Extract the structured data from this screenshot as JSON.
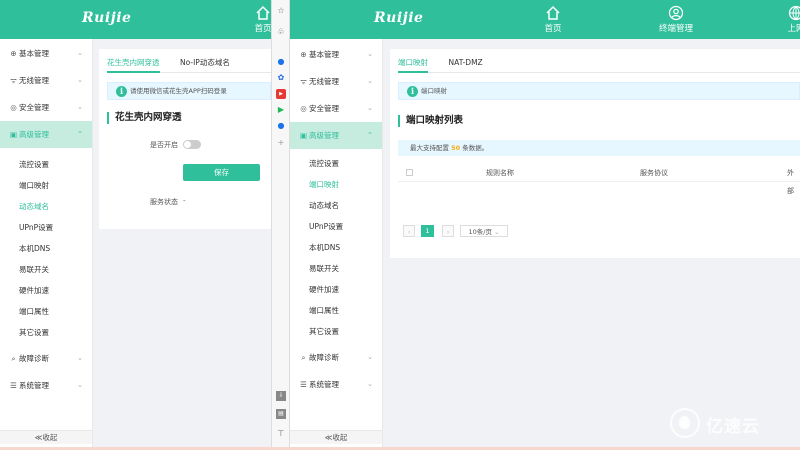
{
  "left_window": {
    "brand": "Ruijie",
    "nav": [
      {
        "label": "首页",
        "icon": "home-icon"
      }
    ],
    "sidebar": {
      "items": [
        {
          "label": "基本管理",
          "icon": "globe-icon"
        },
        {
          "label": "无线管理",
          "icon": "wifi-icon"
        },
        {
          "label": "安全管理",
          "icon": "shield-icon"
        },
        {
          "label": "高级管理",
          "icon": "advanced-icon",
          "active": true
        }
      ],
      "sub_items": [
        "流控设置",
        "端口映射",
        "动态域名",
        "UPnP设置",
        "本机DNS",
        "易联开关",
        "硬件加速",
        "端口属性",
        "其它设置"
      ],
      "active_sub": "动态域名",
      "bottom_items": [
        {
          "label": "故障诊断",
          "icon": "diagnose-icon"
        },
        {
          "label": "系统管理",
          "icon": "system-icon"
        }
      ],
      "collapse_label": "≪收起"
    },
    "tabs": [
      "花生壳内网穿透",
      "No-IP动态域名"
    ],
    "alert_text": "请使用微信或花生壳APP扫码登录",
    "section_title": "花生壳内网穿透",
    "enable_label": "是否开启",
    "enable_value": false,
    "save_label": "保存",
    "status_label": "服务状态",
    "status_value": "-"
  },
  "right_window": {
    "brand": "Ruijie",
    "nav": [
      {
        "label": "首页",
        "icon": "home-icon"
      },
      {
        "label": "终端管理",
        "icon": "user-icon"
      },
      {
        "label": "上网",
        "icon": "globe-icon"
      }
    ],
    "sidebar": {
      "items": [
        {
          "label": "基本管理",
          "icon": "globe-icon"
        },
        {
          "label": "无线管理",
          "icon": "wifi-icon"
        },
        {
          "label": "安全管理",
          "icon": "shield-icon"
        },
        {
          "label": "高级管理",
          "icon": "advanced-icon",
          "active": true
        }
      ],
      "sub_items": [
        "流控设置",
        "端口映射",
        "动态域名",
        "UPnP设置",
        "本机DNS",
        "易联开关",
        "硬件加速",
        "端口属性",
        "其它设置"
      ],
      "active_sub": "端口映射",
      "bottom_items": [
        {
          "label": "故障诊断",
          "icon": "diagnose-icon"
        },
        {
          "label": "系统管理",
          "icon": "system-icon"
        }
      ],
      "collapse_label": "≪收起"
    },
    "tabs": [
      "端口映射",
      "NAT-DMZ"
    ],
    "alert_text": "端口映射",
    "section_title": "端口映射列表",
    "limit_prefix": "最大支持配置",
    "limit_num": "50",
    "limit_suffix": "条数据。",
    "table_headers": [
      "规则名称",
      "服务协议",
      "外部"
    ],
    "pagination": {
      "prev": "‹",
      "current": "1",
      "next": "›",
      "page_size": "10条/页"
    }
  },
  "browser_strip_icons": [
    "star-icon",
    "paint-icon",
    "extension-icon",
    "paw-icon",
    "video-icon",
    "play-icon",
    "info-icon",
    "plus-icon",
    "download-icon",
    "save-icon",
    "pin-icon"
  ],
  "watermark": {
    "text": "亿速云"
  },
  "colors": {
    "brand": "#2fbf9b",
    "active_bg": "#c6ece0",
    "alert_bg": "#e6f7ff"
  }
}
